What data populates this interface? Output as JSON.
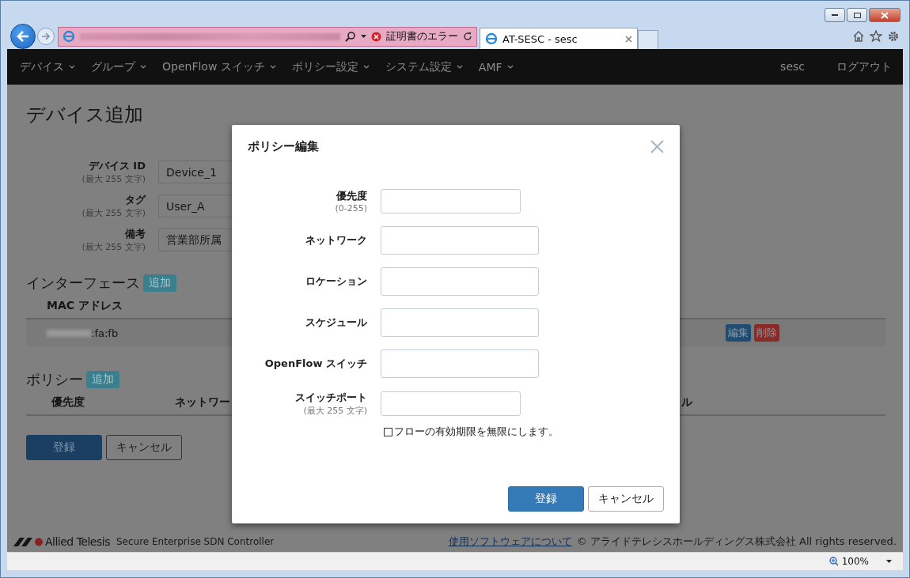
{
  "browser": {
    "tab_title": "AT-SESC - sesc",
    "certificate_error": "証明書のエラー",
    "zoom": "100%"
  },
  "navbar": {
    "menus": [
      {
        "label": "デバイス"
      },
      {
        "label": "グループ"
      },
      {
        "label": "OpenFlow スイッチ"
      },
      {
        "label": "ポリシー設定"
      },
      {
        "label": "システム設定"
      },
      {
        "label": "AMF"
      }
    ],
    "user": "sesc",
    "logout": "ログアウト"
  },
  "page": {
    "title": "デバイス追加",
    "fields": [
      {
        "label": "デバイス ID",
        "hint": "(最大 255 文字)",
        "value": "Device_1"
      },
      {
        "label": "タグ",
        "hint": "(最大 255 文字)",
        "value": "User_A"
      },
      {
        "label": "備考",
        "hint": "(最大 255 文字)",
        "value": "営業部所属"
      }
    ],
    "interfaces": {
      "heading": "インターフェース",
      "add": "追加",
      "column": "MAC アドレス",
      "rows": [
        {
          "mac": ":fa:fb",
          "edit": "編集",
          "delete": "削除"
        }
      ]
    },
    "policies": {
      "heading": "ポリシー",
      "add": "追加",
      "columns": [
        "優先度",
        "ネットワー",
        "ル"
      ]
    },
    "register": "登録",
    "cancel": "キャンセル"
  },
  "footer": {
    "logo": "Allied Telesis",
    "product": "Secure Enterprise SDN Controller",
    "link": "使用ソフトウェアについて",
    "copyright": "© アライドテレシスホールディングス株式会社 All rights reserved."
  },
  "modal": {
    "title": "ポリシー編集",
    "fields": [
      {
        "label": "優先度",
        "hint": "(0-255)",
        "kind": "short"
      },
      {
        "label": "ネットワーク",
        "kind": "wide"
      },
      {
        "label": "ロケーション",
        "kind": "wide"
      },
      {
        "label": "スケジュール",
        "kind": "wide"
      },
      {
        "label": "OpenFlow スイッチ",
        "kind": "wide"
      },
      {
        "label": "スイッチポート",
        "hint": "(最大 255 文字)",
        "kind": "short"
      }
    ],
    "checkbox": {
      "label": "フローの有効期限を無限にします。",
      "checked": false
    },
    "register": "登録",
    "cancel": "キャンセル"
  }
}
